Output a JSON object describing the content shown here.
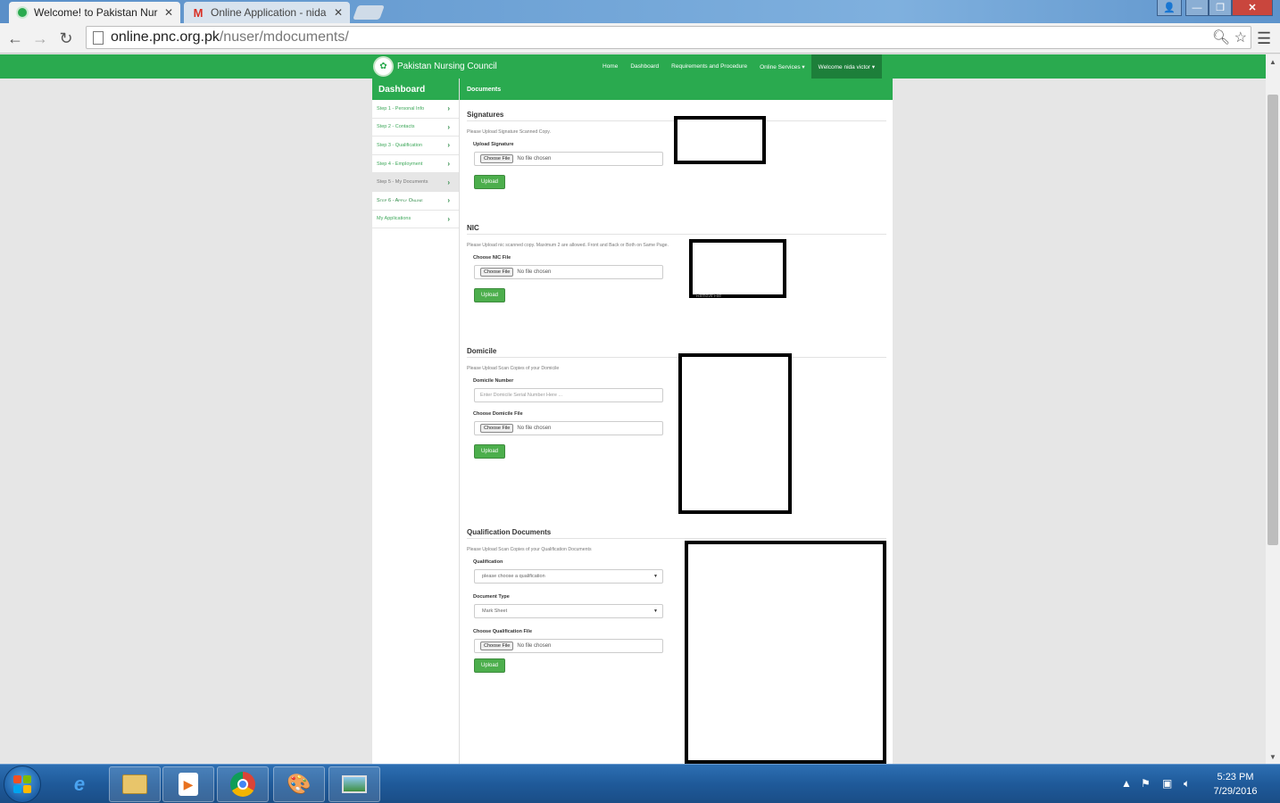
{
  "browser": {
    "tabs": [
      {
        "title": "Welcome! to Pakistan Nur",
        "active": true
      },
      {
        "title": "Online Application - nida",
        "active": false
      }
    ],
    "url_host": "online.pnc.org.pk",
    "url_path": "/nuser/mdocuments/"
  },
  "site": {
    "brand": "Pakistan Nursing Council",
    "nav": {
      "home": "Home",
      "dashboard": "Dashboard",
      "requirements": "Requirements and Procedure",
      "online_services": "Online Services ▾",
      "user": "Welcome nida victor ▾"
    }
  },
  "sidebar": {
    "title": "Dashboard",
    "items": [
      {
        "label": "Step 1 - Personal Info"
      },
      {
        "label": "Step 2 - Contacts"
      },
      {
        "label": "Step 3 - Qualification"
      },
      {
        "label": "Step 4 - Employment"
      },
      {
        "label": "Step 5 - My Documents"
      },
      {
        "label": "Step 6 - Apply Online"
      },
      {
        "label": "My Applications"
      }
    ]
  },
  "main": {
    "title": "Documents",
    "signatures": {
      "heading": "Signatures",
      "help": "Please Upload Signature Scanned Copy.",
      "label": "Upload Signature",
      "choose": "Choose File",
      "no_file": "No file chosen",
      "upload": "Upload"
    },
    "nic": {
      "heading": "NIC",
      "help": "Please Upload nic scanned copy. Maximum 2 are allowed. Front and Back or Both on Same Page.",
      "label": "Choose NIC File",
      "choose": "Choose File",
      "no_file": "No file chosen",
      "upload": "Upload",
      "remove": "Remove File"
    },
    "domicile": {
      "heading": "Domicile",
      "help": "Please Upload Scan Copies of your Domicile",
      "number_label": "Domicile Number",
      "number_placeholder": "Enter Domicile Serial Number Here ...",
      "file_label": "Choose Domicile File",
      "choose": "Choose File",
      "no_file": "No file chosen",
      "upload": "Upload"
    },
    "qualification": {
      "heading": "Qualification Documents",
      "help": "Please Upload Scan Copies of your Qualification Documents",
      "qual_label": "Qualification",
      "qual_selected": "please choose a qualification",
      "doc_type_label": "Document Type",
      "doc_type_selected": "Mark Sheet",
      "file_label": "Choose Qualification File",
      "choose": "Choose File",
      "no_file": "No file chosen",
      "upload": "Upload"
    }
  },
  "taskbar": {
    "time": "5:23 PM",
    "date": "7/29/2016"
  },
  "colors": {
    "brand_green": "#2aaa4f",
    "button_green": "#4cae4c"
  }
}
